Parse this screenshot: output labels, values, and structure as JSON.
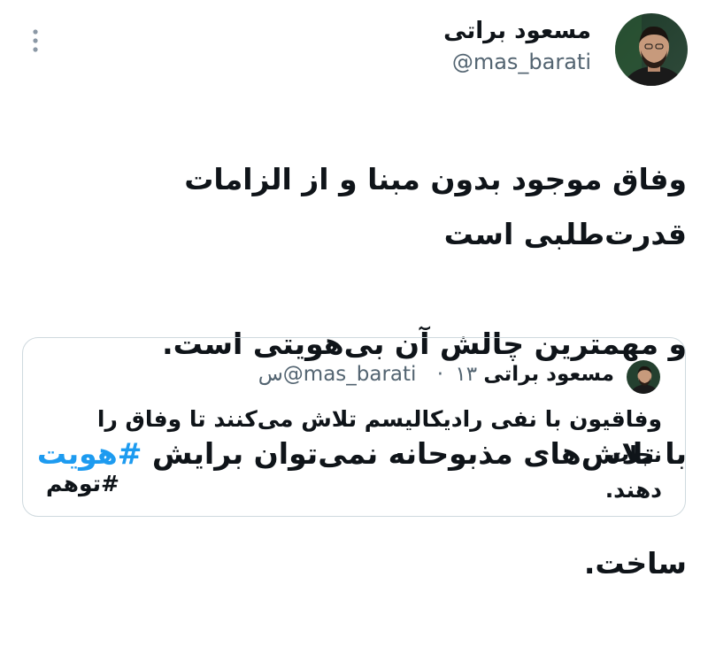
{
  "author": {
    "name": "مسعود براتی",
    "handle": "@mas_barati"
  },
  "tweet": {
    "lines": [
      "وفاق موجود بدون مبنا و از الزامات قدرت‌طلبی است",
      "و مهمترین چالش آن بی‌هویتی است."
    ],
    "line3_text": "با تلاش‌های مذبوحانه نمی‌توان برایش ",
    "line3_hashtag": "#هویت",
    "line4": "ساخت."
  },
  "quote": {
    "name": "مسعود براتی",
    "handle": "@mas_barati",
    "separator": "·",
    "time": "۱۳س",
    "lines": [
      "وفاقیون با نفی رادیکالیسم تلاش می‌کنند تا وفاق را نجات",
      "دهند."
    ],
    "hashtag": "#توهم"
  },
  "icons": {
    "more": "more-vertical-icon",
    "avatar": "avatar"
  },
  "colors": {
    "text": "#0f1419",
    "secondary": "#536471",
    "link": "#1d9bf0",
    "border": "#cfd9de"
  }
}
